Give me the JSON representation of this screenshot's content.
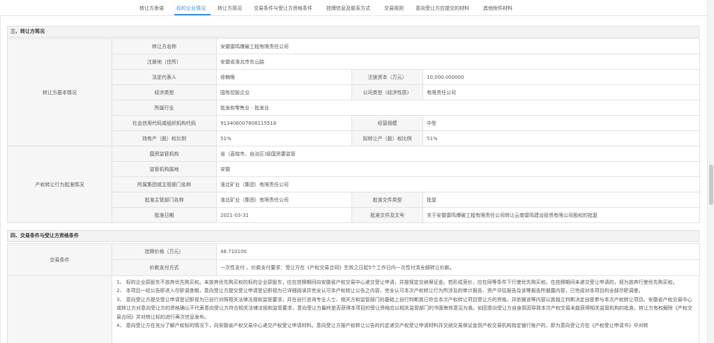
{
  "tabs": [
    {
      "label": "转让方承诺"
    },
    {
      "label": "标的企业情况"
    },
    {
      "label": "转让方简况"
    },
    {
      "label": "交易条件与受让方资格条件"
    },
    {
      "label": "挂牌信息及联系方式"
    },
    {
      "label": "交易规则"
    },
    {
      "label": "意向受让方应提交的材料"
    },
    {
      "label": "其他附件材料"
    }
  ],
  "section3": {
    "title": "三、转让方简况",
    "group1_label": "转让方基本情况",
    "transferor_name_label": "转让方名称",
    "transferor_name": "安徽雷鸣爆破工程有限责任公司",
    "address_label": "注册地（住所）",
    "address": "安徽省淮北市东山路",
    "legal_rep_label": "法定代表人",
    "legal_rep": "徐楠根",
    "reg_capital_label": "注册资本（万元）",
    "reg_capital": "10,000.000000",
    "econ_type_label": "经济类型",
    "econ_type": "国有控股企业",
    "company_type_label": "公司类型（经济性质）",
    "company_type": "有限责任公司",
    "industry_label": "所属行业",
    "industry": "批发和零售业 - 批发业",
    "credit_code_label": "社会信用代码或组织机构代码",
    "credit_code": "913406007608115518",
    "scale_label": "经营规模",
    "scale": "中型",
    "holding_ratio_label": "持有产（股）权比例",
    "holding_ratio": "51%",
    "transfer_ratio_label": "拟转让产（股）权比例",
    "transfer_ratio": "51%",
    "group2_label": "产权转让行为批准情况",
    "regulator_label": "国资监管机构",
    "regulator": "省（直辖市、自治区)级国资委监管",
    "reg_location_label": "监管机构属地",
    "reg_location": "安徽",
    "group_label": "所属集团或主管部门名称",
    "group": "淮北矿业（集团）有限责任公司",
    "approver_label": "批准主管部门名称",
    "approver": "淮北矿业（集团）有限责任公司",
    "doc_type_label": "批准文件类型",
    "doc_type": "批复",
    "approve_date_label": "批准日期",
    "approve_date": "2021-03-31",
    "doc_name_label": "批准文件及文号",
    "doc_name": "关于安徽雷鸣爆破工程有限责任公司转让云南雷鸣建设投资有限公司股权的批复"
  },
  "section4": {
    "title": "四、交易条件与受让方资格条件",
    "group_label": "交易条件",
    "price_label": "挂牌价格（万元）",
    "price": "48.710100",
    "payment_label": "价款支付方式",
    "payment": "一次性支付 ，价款支付要求：受让方在《产权交易合同》生效之日起5个工作日内一次性付清全部转让价款。",
    "notes": [
      "1、 标的企业原股东不放弃优先购买权。未放弃优先购买权的标的企业原股东，应在挂牌期间向安徽省产权交易中心递交受让申请，并按规定交纳保证金。若形成竞价，应在同等条件下行使优先购买权。在挂牌期间未递交受让申请的，视为放弃行使优先购买权。",
      "2、 本项目一经公告即进入尽职调查期，意向受让方提交受让申请登记即视为已详细阅读并完全认可本产权转让公告之内容，完全认可本次产权转让行为所涉及的审计报告、资产评估报告及该等报告所披露内容，已完成对本项目的全部尽职调查。",
      "3、 意向受让方提交受让申请登记即视为已自行对照相关法律法规和监管要求，并在自行咨询专业人士、相关方和监管部门的基础上自行判断其已符合本次产权转让项目受让方的资格，并依据该等内容以其独立判断决定自愿参与本次产权转让项目。安徽省产权交易中心或转让方对意向受让方的资格确认不代表意向受让方符合相关法律法规和监管要求，意向受让方最终是否获得本项目的受让资格应以相关监管部门的书面审核意见为准。如因意向受让方自身原因导致本次产权交易未能获得相关监管机构的批准，转让方有权解除《产权交易合同》并对转让标的进行再次信息发布。",
      "4、 意向受让方在充分了解产权标的情况下，向安徽省产权交易中心递交产权受让申请材料。意向受让方按产权转让公告的约定递交产权受让申请材料并交纳交易保证金到产权交易机构指定银行账户的，即为意向受让方在《产权受让申请书》中对转"
    ]
  },
  "colors": {
    "accent": "#3b8fd9",
    "label_bg": "#f6f6f6",
    "border": "#e2e2e2",
    "section_bg": "#f3f3f3"
  }
}
